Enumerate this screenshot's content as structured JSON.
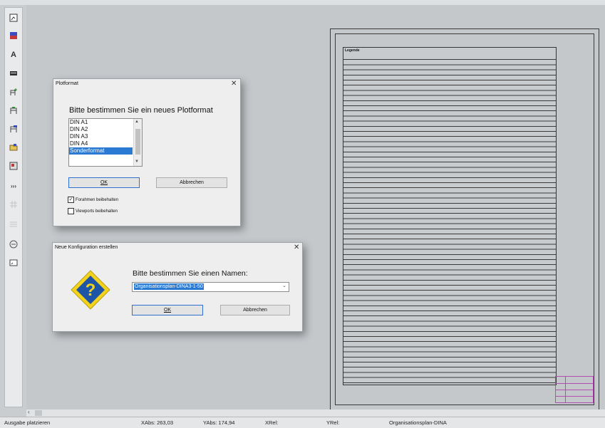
{
  "plot_dialog": {
    "title": "Plotformat",
    "close": "✕",
    "prompt": "Bitte bestimmen Sie ein neues Plotformat",
    "formats": [
      {
        "label": "DIN A1",
        "selected": false
      },
      {
        "label": "DIN A2",
        "selected": false
      },
      {
        "label": "DIN A3",
        "selected": false
      },
      {
        "label": "DIN A4",
        "selected": false
      },
      {
        "label": "Sonderformat",
        "selected": true
      }
    ],
    "ok_label": "OK",
    "cancel_label": "Abbrechen",
    "option_frame": "Forahmen beibehalten",
    "option_frame_checked": true,
    "option_viewports": "Viewports beibehalten",
    "option_viewports_checked": false
  },
  "config_dialog": {
    "title": "Neue Konfiguration erstellen",
    "close": "✕",
    "prompt": "Bitte bestimmen Sie einen Namen:",
    "name_value": "Organisationsplan-DINA3-1-50",
    "ok_label": "OK",
    "cancel_label": "Abbrechen",
    "icon": "question-icon"
  },
  "legend": {
    "title": "Legende"
  },
  "statusbar": {
    "mode": "Ausgabe platzieren",
    "xabs": "XAbs: 263,03",
    "yabs": "YAbs: 174,94",
    "xrel": "XRel:",
    "yrel": "YRel:",
    "config": "Organisationsplan-DINA"
  },
  "toolbar_icons": [
    "insert-image-icon",
    "color-fill-icon",
    "text-icon",
    "dimension-icon",
    "add-frame-icon",
    "frame-icon",
    "frame-edit-icon",
    "folder-icon",
    "stamp-icon",
    "more-icon",
    "grid-icon",
    "grid-2-icon",
    "symbol-icon",
    "viewport-icon"
  ],
  "colors": {
    "selection": "#2a79d2",
    "stamp": "#b34cb3",
    "question_yellow": "#f3d21c",
    "question_blue": "#1f55a6"
  }
}
